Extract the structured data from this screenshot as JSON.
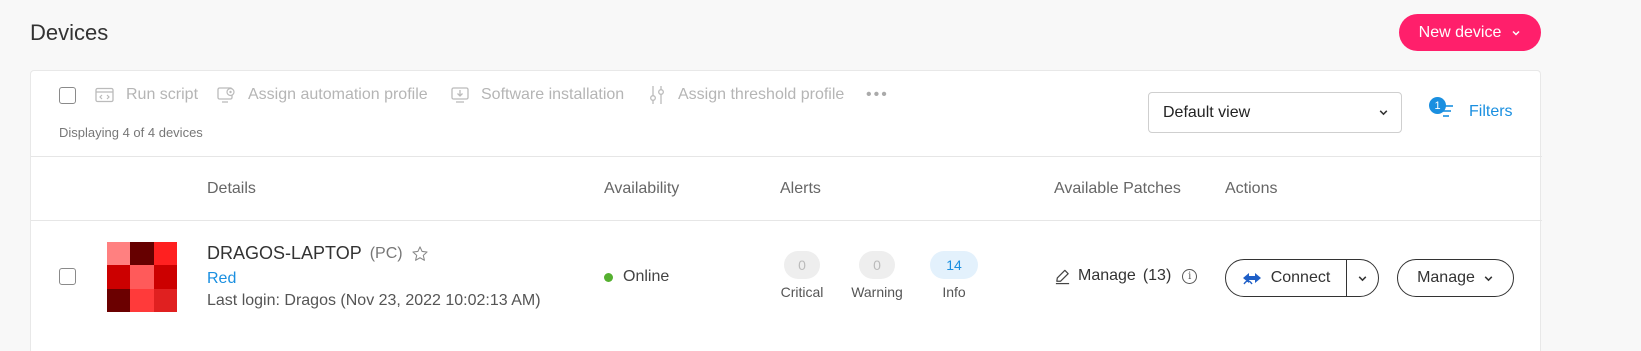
{
  "page": {
    "title": "Devices",
    "new_device_label": "New device"
  },
  "toolbar": {
    "run_script": "Run script",
    "assign_automation_profile": "Assign automation profile",
    "software_installation": "Software installation",
    "assign_threshold_profile": "Assign threshold profile",
    "more": "•••",
    "display_count": "Displaying 4 of 4 devices",
    "view_select": "Default view",
    "filters_label": "Filters",
    "filters_count": "1"
  },
  "columns": [
    "Details",
    "Availability",
    "Alerts",
    "Available Patches",
    "Actions"
  ],
  "device": {
    "name": "DRAGOS-LAPTOP",
    "type": "(PC)",
    "group": "Red",
    "last_login": "Last login: Dragos (Nov 23, 2022 10:02:13 AM)",
    "availability": "Online",
    "alerts": [
      {
        "count": "0",
        "label": "Critical"
      },
      {
        "count": "0",
        "label": "Warning"
      },
      {
        "count": "14",
        "label": "Info"
      }
    ],
    "patches_label": "Manage",
    "patches_count": "(13)",
    "connect_label": "Connect",
    "manage_label": "Manage",
    "thumbnail_colors": [
      "#ff8080",
      "#660000",
      "#ff2020",
      "#cc0000",
      "#ff5a5a",
      "#cc0000",
      "#6b0000",
      "#ff3a3a",
      "#e02020"
    ]
  },
  "colors": {
    "accent": "#ff1f6b",
    "link": "#1a8fe0",
    "online": "#55b030",
    "info_pill": "#e3f1fc",
    "neutral_pill": "#eeeeee"
  }
}
